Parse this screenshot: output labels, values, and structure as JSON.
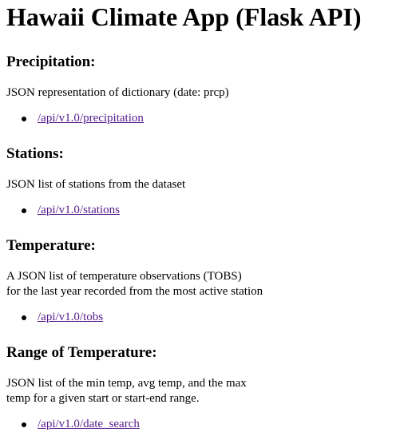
{
  "page_title": "Hawaii Climate App (Flask API)",
  "sections": [
    {
      "heading": "Precipitation:",
      "description_lines": [
        "JSON representation of dictionary (date: prcp)"
      ],
      "link": "/api/v1.0/precipitation"
    },
    {
      "heading": "Stations:",
      "description_lines": [
        "JSON list of stations from the dataset"
      ],
      "link": "/api/v1.0/stations"
    },
    {
      "heading": "Temperature:",
      "description_lines": [
        "A JSON list of temperature observations (TOBS)",
        "for the last year recorded from the most active station"
      ],
      "link": "/api/v1.0/tobs"
    },
    {
      "heading": "Range of Temperature:",
      "description_lines": [
        "JSON list of the min temp, avg temp, and the max",
        "temp for a given start or start-end range."
      ],
      "link": "/api/v1.0/date_search"
    }
  ],
  "colors": {
    "text": "#000000",
    "link_visited": "#551a8b",
    "background": "#ffffff"
  }
}
